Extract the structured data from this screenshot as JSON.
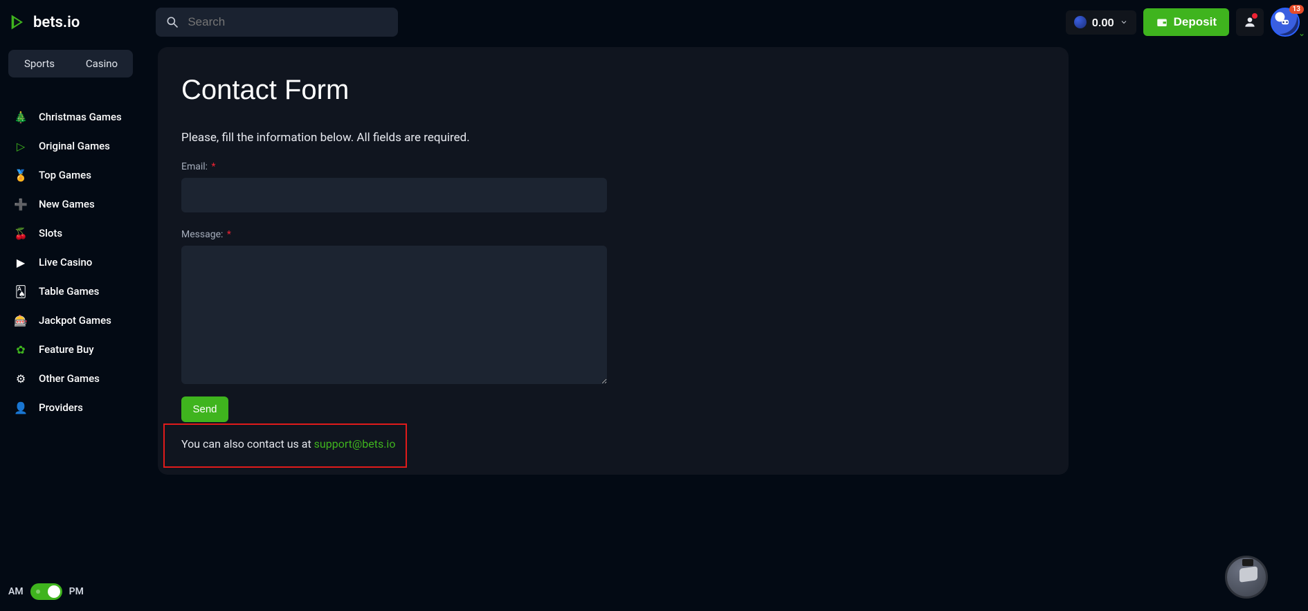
{
  "brand": "bets.io",
  "search": {
    "placeholder": "Search"
  },
  "balance": {
    "amount": "0.00"
  },
  "deposit_label": "Deposit",
  "notification_count": "13",
  "nav_tabs": {
    "sports": "Sports",
    "casino": "Casino"
  },
  "sidebar": [
    {
      "icon": "🎄",
      "label": "Christmas Games"
    },
    {
      "icon": "▷",
      "label": "Original Games"
    },
    {
      "icon": "🏅",
      "label": "Top Games"
    },
    {
      "icon": "➕",
      "label": "New Games"
    },
    {
      "icon": "🍒",
      "label": "Slots"
    },
    {
      "icon": "▶",
      "label": "Live Casino"
    },
    {
      "icon": "🂡",
      "label": "Table Games"
    },
    {
      "icon": "🎰",
      "label": "Jackpot Games"
    },
    {
      "icon": "✿",
      "label": "Feature Buy"
    },
    {
      "icon": "⚙",
      "label": "Other Games"
    },
    {
      "icon": "👤",
      "label": "Providers"
    }
  ],
  "am_label": "AM",
  "pm_label": "PM",
  "page": {
    "title": "Contact Form",
    "subtitle": "Please, fill the information below. All fields are required.",
    "email_label": "Email:",
    "message_label": "Message:",
    "send_label": "Send",
    "contact_prefix": "You can also contact us at ",
    "contact_email": "support@bets.io"
  }
}
